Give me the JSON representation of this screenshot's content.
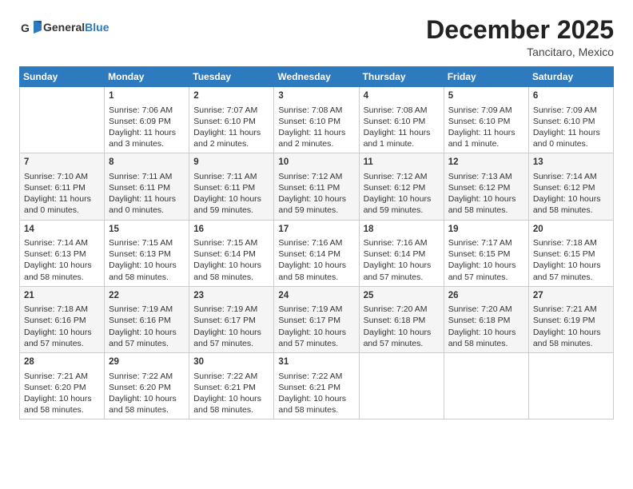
{
  "header": {
    "logo_general": "General",
    "logo_blue": "Blue",
    "month": "December 2025",
    "location": "Tancitaro, Mexico"
  },
  "weekdays": [
    "Sunday",
    "Monday",
    "Tuesday",
    "Wednesday",
    "Thursday",
    "Friday",
    "Saturday"
  ],
  "weeks": [
    [
      {
        "day": "",
        "info": ""
      },
      {
        "day": "1",
        "info": "Sunrise: 7:06 AM\nSunset: 6:09 PM\nDaylight: 11 hours\nand 3 minutes."
      },
      {
        "day": "2",
        "info": "Sunrise: 7:07 AM\nSunset: 6:10 PM\nDaylight: 11 hours\nand 2 minutes."
      },
      {
        "day": "3",
        "info": "Sunrise: 7:08 AM\nSunset: 6:10 PM\nDaylight: 11 hours\nand 2 minutes."
      },
      {
        "day": "4",
        "info": "Sunrise: 7:08 AM\nSunset: 6:10 PM\nDaylight: 11 hours\nand 1 minute."
      },
      {
        "day": "5",
        "info": "Sunrise: 7:09 AM\nSunset: 6:10 PM\nDaylight: 11 hours\nand 1 minute."
      },
      {
        "day": "6",
        "info": "Sunrise: 7:09 AM\nSunset: 6:10 PM\nDaylight: 11 hours\nand 0 minutes."
      }
    ],
    [
      {
        "day": "7",
        "info": "Sunrise: 7:10 AM\nSunset: 6:11 PM\nDaylight: 11 hours\nand 0 minutes."
      },
      {
        "day": "8",
        "info": "Sunrise: 7:11 AM\nSunset: 6:11 PM\nDaylight: 11 hours\nand 0 minutes."
      },
      {
        "day": "9",
        "info": "Sunrise: 7:11 AM\nSunset: 6:11 PM\nDaylight: 10 hours\nand 59 minutes."
      },
      {
        "day": "10",
        "info": "Sunrise: 7:12 AM\nSunset: 6:11 PM\nDaylight: 10 hours\nand 59 minutes."
      },
      {
        "day": "11",
        "info": "Sunrise: 7:12 AM\nSunset: 6:12 PM\nDaylight: 10 hours\nand 59 minutes."
      },
      {
        "day": "12",
        "info": "Sunrise: 7:13 AM\nSunset: 6:12 PM\nDaylight: 10 hours\nand 58 minutes."
      },
      {
        "day": "13",
        "info": "Sunrise: 7:14 AM\nSunset: 6:12 PM\nDaylight: 10 hours\nand 58 minutes."
      }
    ],
    [
      {
        "day": "14",
        "info": "Sunrise: 7:14 AM\nSunset: 6:13 PM\nDaylight: 10 hours\nand 58 minutes."
      },
      {
        "day": "15",
        "info": "Sunrise: 7:15 AM\nSunset: 6:13 PM\nDaylight: 10 hours\nand 58 minutes."
      },
      {
        "day": "16",
        "info": "Sunrise: 7:15 AM\nSunset: 6:14 PM\nDaylight: 10 hours\nand 58 minutes."
      },
      {
        "day": "17",
        "info": "Sunrise: 7:16 AM\nSunset: 6:14 PM\nDaylight: 10 hours\nand 58 minutes."
      },
      {
        "day": "18",
        "info": "Sunrise: 7:16 AM\nSunset: 6:14 PM\nDaylight: 10 hours\nand 57 minutes."
      },
      {
        "day": "19",
        "info": "Sunrise: 7:17 AM\nSunset: 6:15 PM\nDaylight: 10 hours\nand 57 minutes."
      },
      {
        "day": "20",
        "info": "Sunrise: 7:18 AM\nSunset: 6:15 PM\nDaylight: 10 hours\nand 57 minutes."
      }
    ],
    [
      {
        "day": "21",
        "info": "Sunrise: 7:18 AM\nSunset: 6:16 PM\nDaylight: 10 hours\nand 57 minutes."
      },
      {
        "day": "22",
        "info": "Sunrise: 7:19 AM\nSunset: 6:16 PM\nDaylight: 10 hours\nand 57 minutes."
      },
      {
        "day": "23",
        "info": "Sunrise: 7:19 AM\nSunset: 6:17 PM\nDaylight: 10 hours\nand 57 minutes."
      },
      {
        "day": "24",
        "info": "Sunrise: 7:19 AM\nSunset: 6:17 PM\nDaylight: 10 hours\nand 57 minutes."
      },
      {
        "day": "25",
        "info": "Sunrise: 7:20 AM\nSunset: 6:18 PM\nDaylight: 10 hours\nand 57 minutes."
      },
      {
        "day": "26",
        "info": "Sunrise: 7:20 AM\nSunset: 6:18 PM\nDaylight: 10 hours\nand 58 minutes."
      },
      {
        "day": "27",
        "info": "Sunrise: 7:21 AM\nSunset: 6:19 PM\nDaylight: 10 hours\nand 58 minutes."
      }
    ],
    [
      {
        "day": "28",
        "info": "Sunrise: 7:21 AM\nSunset: 6:20 PM\nDaylight: 10 hours\nand 58 minutes."
      },
      {
        "day": "29",
        "info": "Sunrise: 7:22 AM\nSunset: 6:20 PM\nDaylight: 10 hours\nand 58 minutes."
      },
      {
        "day": "30",
        "info": "Sunrise: 7:22 AM\nSunset: 6:21 PM\nDaylight: 10 hours\nand 58 minutes."
      },
      {
        "day": "31",
        "info": "Sunrise: 7:22 AM\nSunset: 6:21 PM\nDaylight: 10 hours\nand 58 minutes."
      },
      {
        "day": "",
        "info": ""
      },
      {
        "day": "",
        "info": ""
      },
      {
        "day": "",
        "info": ""
      }
    ]
  ]
}
